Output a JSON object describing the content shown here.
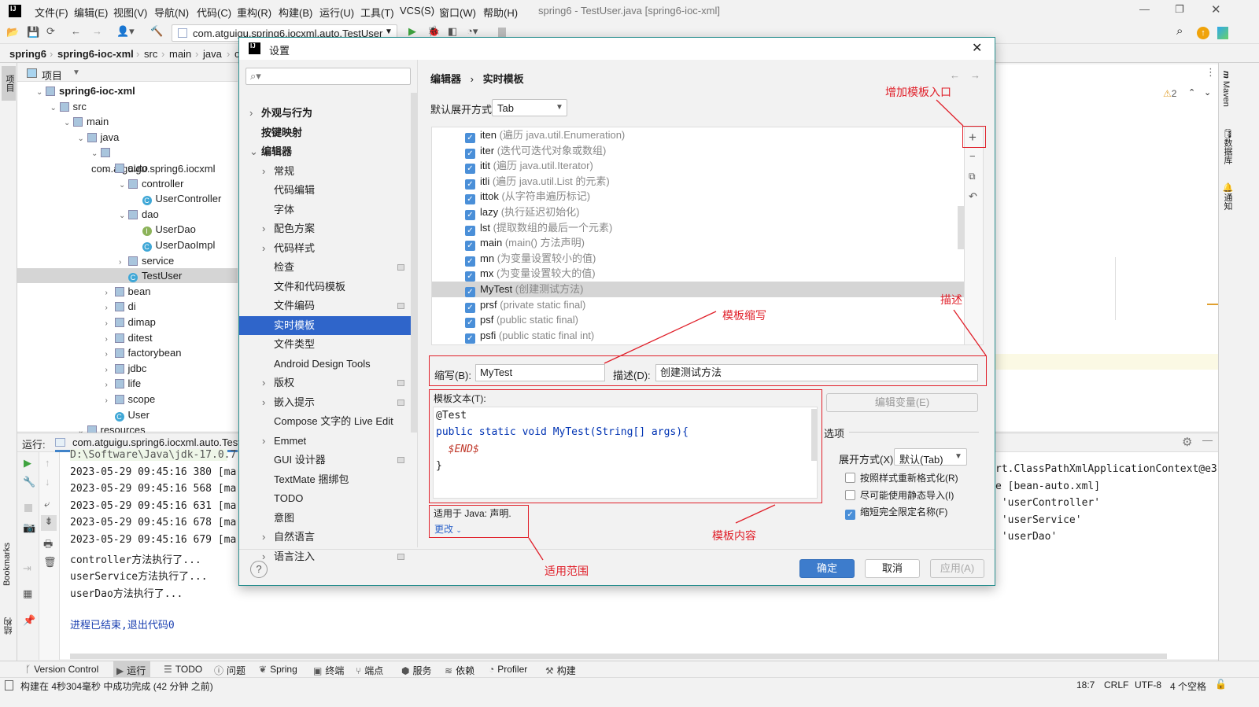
{
  "window": {
    "title": "spring6 - TestUser.java [spring6-ioc-xml]",
    "menus": [
      "文件(F)",
      "编辑(E)",
      "视图(V)",
      "导航(N)",
      "代码(C)",
      "重构(R)",
      "构建(B)",
      "运行(U)",
      "工具(T)",
      "VCS(S)",
      "窗口(W)",
      "帮助(H)"
    ]
  },
  "toolbar": {
    "run_config": "com.atguigu.spring6.iocxml.auto.TestUser"
  },
  "breadcrumb": [
    "spring6",
    "spring6-ioc-xml",
    "src",
    "main",
    "java",
    "c"
  ],
  "left_stripe": {
    "project": "项目",
    "bookmarks": "Bookmarks",
    "structure": "结构"
  },
  "right_stripe": {
    "maven": "Maven",
    "database": "数据库",
    "notifications": "通知"
  },
  "project": {
    "title": "项目",
    "tree": [
      {
        "label": "spring6-ioc-xml",
        "lvl": 0,
        "kind": "module",
        "open": true,
        "bold": true
      },
      {
        "label": "src",
        "lvl": 1,
        "kind": "folder",
        "open": true
      },
      {
        "label": "main",
        "lvl": 2,
        "kind": "folder",
        "open": true
      },
      {
        "label": "java",
        "lvl": 3,
        "kind": "folder",
        "open": true
      },
      {
        "label": "com.atguigu.spring6.iocxml",
        "lvl": 4,
        "kind": "folder",
        "open": true
      },
      {
        "label": "auto",
        "lvl": 5,
        "kind": "folder",
        "open": true
      },
      {
        "label": "controller",
        "lvl": 6,
        "kind": "folder",
        "open": true
      },
      {
        "label": "UserController",
        "lvl": 7,
        "kind": "class"
      },
      {
        "label": "dao",
        "lvl": 6,
        "kind": "folder",
        "open": true
      },
      {
        "label": "UserDao",
        "lvl": 7,
        "kind": "interface"
      },
      {
        "label": "UserDaoImpl",
        "lvl": 7,
        "kind": "class"
      },
      {
        "label": "service",
        "lvl": 6,
        "kind": "folder",
        "open": false
      },
      {
        "label": "TestUser",
        "lvl": 6,
        "kind": "class",
        "selected": true
      },
      {
        "label": "bean",
        "lvl": 5,
        "kind": "folder",
        "open": false
      },
      {
        "label": "di",
        "lvl": 5,
        "kind": "folder",
        "open": false
      },
      {
        "label": "dimap",
        "lvl": 5,
        "kind": "folder",
        "open": false
      },
      {
        "label": "ditest",
        "lvl": 5,
        "kind": "folder",
        "open": false
      },
      {
        "label": "factorybean",
        "lvl": 5,
        "kind": "folder",
        "open": false
      },
      {
        "label": "jdbc",
        "lvl": 5,
        "kind": "folder",
        "open": false
      },
      {
        "label": "life",
        "lvl": 5,
        "kind": "folder",
        "open": false
      },
      {
        "label": "scope",
        "lvl": 5,
        "kind": "folder",
        "open": false
      },
      {
        "label": "User",
        "lvl": 5,
        "kind": "class"
      },
      {
        "label": "resources",
        "lvl": 3,
        "kind": "folder",
        "open": true
      }
    ]
  },
  "editor": {
    "warnings": "2"
  },
  "run": {
    "label": "运行:",
    "tab": "com.atguigu.spring6.iocxml.auto.Test",
    "lines": [
      "D:\\Software\\Java\\jdk-17.0.7",
      "2023-05-29 09:45:16 380 [ma",
      "2023-05-29 09:45:16 568 [ma",
      "2023-05-29 09:45:16 631 [ma",
      "2023-05-29 09:45:16 678 [ma",
      "2023-05-29 09:45:16 679 [ma",
      "controller方法执行了...",
      "userService方法执行了...",
      "userDao方法执行了..."
    ],
    "right_fragments": [
      "rt.ClassPathXmlApplicationContext@e3",
      "e [bean-auto.xml]",
      " 'userController'",
      " 'userService'",
      " 'userDao'"
    ],
    "exit": "进程已结束,退出代码0"
  },
  "bottom_tools": [
    {
      "label": "Version Control",
      "icon": "branch-icon"
    },
    {
      "label": "运行",
      "icon": "play-icon",
      "active": true
    },
    {
      "label": "TODO",
      "icon": "list-icon"
    },
    {
      "label": "问题",
      "icon": "problem-icon"
    },
    {
      "label": "Spring",
      "icon": "spring-icon"
    },
    {
      "label": "终端",
      "icon": "terminal-icon"
    },
    {
      "label": "端点",
      "icon": "endpoints-icon"
    },
    {
      "label": "服务",
      "icon": "services-icon"
    },
    {
      "label": "依赖",
      "icon": "dependencies-icon"
    },
    {
      "label": "Profiler",
      "icon": "profiler-icon"
    },
    {
      "label": "构建",
      "icon": "hammer-icon"
    }
  ],
  "status": {
    "message": "构建在 4秒304毫秒 中成功完成 (42 分钟 之前)",
    "position": "18:7",
    "line_sep": "CRLF",
    "encoding": "UTF-8",
    "indent": "4 个空格"
  },
  "dialog": {
    "title": "设置",
    "search_placeholder": "",
    "nav": [
      {
        "label": "外观与行为",
        "lvl": 0,
        "chev": "right",
        "bold": true
      },
      {
        "label": "按键映射",
        "lvl": 0,
        "bold": true
      },
      {
        "label": "编辑器",
        "lvl": 0,
        "chev": "down",
        "bold": true
      },
      {
        "label": "常规",
        "lvl": 1,
        "chev": "right"
      },
      {
        "label": "代码编辑",
        "lvl": 1
      },
      {
        "label": "字体",
        "lvl": 1
      },
      {
        "label": "配色方案",
        "lvl": 1,
        "chev": "right"
      },
      {
        "label": "代码样式",
        "lvl": 1,
        "chev": "right"
      },
      {
        "label": "检查",
        "lvl": 1,
        "badge": true
      },
      {
        "label": "文件和代码模板",
        "lvl": 1
      },
      {
        "label": "文件编码",
        "lvl": 1,
        "badge": true
      },
      {
        "label": "实时模板",
        "lvl": 1,
        "selected": true
      },
      {
        "label": "文件类型",
        "lvl": 1
      },
      {
        "label": "Android Design Tools",
        "lvl": 1
      },
      {
        "label": "版权",
        "lvl": 1,
        "chev": "right",
        "badge": true
      },
      {
        "label": "嵌入提示",
        "lvl": 1,
        "chev": "right",
        "badge": true
      },
      {
        "label": "Compose 文字的 Live Edit",
        "lvl": 1
      },
      {
        "label": "Emmet",
        "lvl": 1,
        "chev": "right"
      },
      {
        "label": "GUI 设计器",
        "lvl": 1,
        "badge": true
      },
      {
        "label": "TextMate 捆绑包",
        "lvl": 1
      },
      {
        "label": "TODO",
        "lvl": 1
      },
      {
        "label": "意图",
        "lvl": 1
      },
      {
        "label": "自然语言",
        "lvl": 1,
        "chev": "right"
      },
      {
        "label": "语言注入",
        "lvl": 1,
        "chev": "right",
        "badge": true
      }
    ],
    "crumb": [
      "编辑器",
      "实时模板"
    ],
    "expand_label": "默认展开方式",
    "expand_value": "Tab",
    "templates": [
      {
        "abbr": "iten",
        "desc": "(遍历 java.util.Enumeration)"
      },
      {
        "abbr": "iter",
        "desc": "(迭代可迭代对象或数组)"
      },
      {
        "abbr": "itit",
        "desc": "(遍历 java.util.Iterator)"
      },
      {
        "abbr": "itli",
        "desc": "(遍历 java.util.List 的元素)"
      },
      {
        "abbr": "ittok",
        "desc": "(从字符串遍历标记)"
      },
      {
        "abbr": "lazy",
        "desc": "(执行延迟初始化)"
      },
      {
        "abbr": "lst",
        "desc": "(提取数组的最后一个元素)"
      },
      {
        "abbr": "main",
        "desc": "(main() 方法声明)"
      },
      {
        "abbr": "mn",
        "desc": "(为变量设置较小的值)"
      },
      {
        "abbr": "mx",
        "desc": "(为变量设置较大的值)"
      },
      {
        "abbr": "MyTest",
        "desc": "(创建测试方法)",
        "selected": true
      },
      {
        "abbr": "prsf",
        "desc": "(private static final)"
      },
      {
        "abbr": "psf",
        "desc": "(public static final)"
      },
      {
        "abbr": "psfi",
        "desc": "(public static final int)"
      }
    ],
    "abbr_label": "缩写(B):",
    "abbr_value": "MyTest",
    "desc_label": "描述(D):",
    "desc_value": "创建测试方法",
    "text_label": "模板文本(T):",
    "code": [
      "@Test",
      "public static void MyTest(String[] args){",
      "  $END$",
      "}"
    ],
    "edit_vars": "编辑变量(E)",
    "options": "选项",
    "expand_with_label": "展开方式(X)",
    "expand_with_value": "默认(Tab)",
    "checks": [
      {
        "label": "按照样式重新格式化(R)",
        "checked": false
      },
      {
        "label": "尽可能使用静态导入(I)",
        "checked": false
      },
      {
        "label": "缩短完全限定名称(F)",
        "checked": true
      }
    ],
    "applies": "适用于 Java: 声明.",
    "change": "更改",
    "ok": "确定",
    "cancel": "取消",
    "apply": "应用(A)"
  },
  "annotations": {
    "add": "增加模板入口",
    "abbr": "模板缩写",
    "desc": "描述",
    "content": "模板内容",
    "scope": "适用范围",
    "color": "#e0202a"
  }
}
